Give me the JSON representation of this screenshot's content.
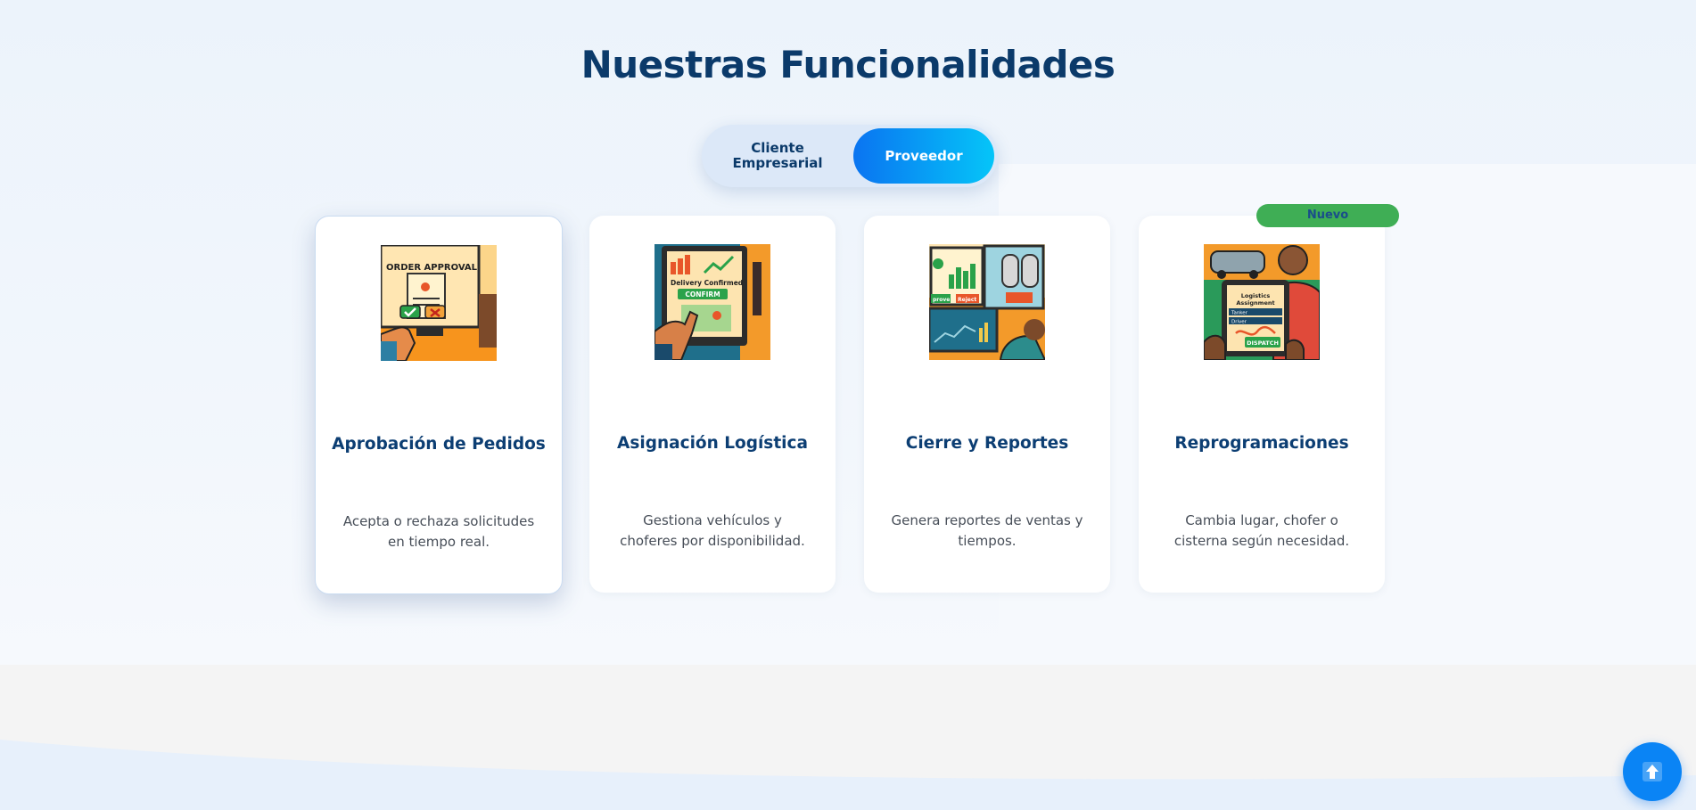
{
  "section": {
    "title": "Nuestras Funcionalidades"
  },
  "toggle": {
    "options": [
      {
        "label": "Cliente Empresarial",
        "selected": false
      },
      {
        "label": "Proveedor",
        "selected": true
      }
    ]
  },
  "cards": [
    {
      "title": "Aprobación de Pedidos",
      "description": "Acepta o rechaza solicitudes en tiempo real.",
      "image_text": "ORDER APPROVAL",
      "icon": "order-approval-illustration"
    },
    {
      "title": "Asignación Logística",
      "description": "Gestiona vehículos y choferes por disponibilidad.",
      "image_text": "Delivery Confirmed",
      "image_button": "CONFIRM",
      "icon": "delivery-confirmed-illustration"
    },
    {
      "title": "Cierre y Reportes",
      "description": "Genera reportes de ventas y tiempos.",
      "image_text": "Reject",
      "image_text2": "prove",
      "icon": "reports-dashboard-illustration"
    },
    {
      "title": "Reprogramaciones",
      "description": "Cambia lugar, chofer o cisterna según necesidad.",
      "image_text": "Logistics Assignment",
      "image_row1": "Tanker",
      "image_row2": "Driver",
      "image_button": "DISPATCH",
      "icon": "logistics-assignment-illustration"
    }
  ],
  "badge": {
    "label": "Nuevo"
  },
  "fab": {
    "icon": "scroll-to-top-icon"
  },
  "colors": {
    "title": "#0b3a6a",
    "accent_start": "#0a74f1",
    "accent_end": "#05c5f8",
    "badge": "#3fae55",
    "fab": "#0a84f5"
  }
}
